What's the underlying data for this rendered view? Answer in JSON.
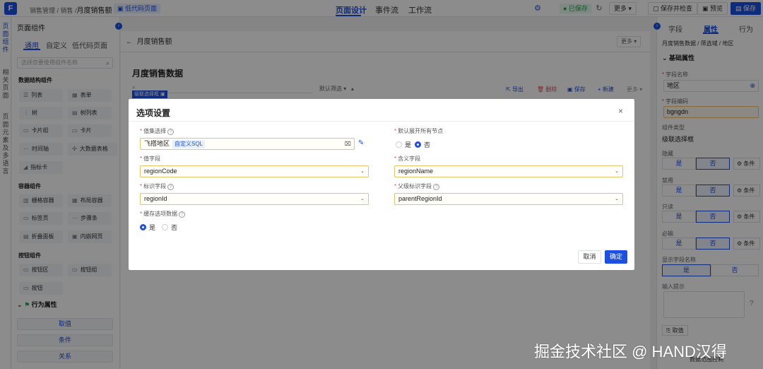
{
  "topbar": {
    "breadcrumb_prefix": "销售管理 / 销售 /",
    "page_name": "月度销售额",
    "low_code_tag": "低代码页面",
    "tabs": [
      "页面设计",
      "事件流",
      "工作流"
    ],
    "saved": "已保存",
    "more": "更多",
    "save_check": "保存并检查",
    "preview": "预览",
    "save": "保存"
  },
  "left_strip": {
    "items": [
      "页面组件",
      "相关页面",
      "页面元素及多语言"
    ]
  },
  "left_panel": {
    "title": "页面组件",
    "tabs": [
      "通用",
      "自定义",
      "低代码页面"
    ],
    "search_placeholder": "选择您要使用组件名称",
    "sections": {
      "data": "数据结构组件",
      "container": "容器组件",
      "button": "按钮组件"
    },
    "data_items": [
      "列表",
      "表单",
      "树",
      "树列表",
      "卡片组",
      "卡片",
      "时间轴",
      "大数据表格",
      "指标卡"
    ],
    "container_items": [
      "栅格容器",
      "布局容器",
      "标签页",
      "步骤条",
      "折叠面板",
      "内嵌网页"
    ],
    "button_items": [
      "按钮区",
      "按钮组",
      "按钮"
    ],
    "behavior_title": "行为属性",
    "behavior_buttons": [
      "取值",
      "条件",
      "关系"
    ]
  },
  "canvas": {
    "back_title": "月度销售额",
    "more": "更多",
    "page_title": "月度销售数据",
    "quick_query": "默认筛选",
    "tools": [
      "导出",
      "删除",
      "保存",
      "新建",
      "更多"
    ],
    "selected_chip": "级联选择框"
  },
  "right_panel": {
    "tabs": [
      "字段",
      "属性",
      "行为"
    ],
    "breadcrumb": "月度销售数据 / 筛选域 / 地区",
    "section": "基础属性",
    "field_name_label": "字段名称",
    "field_name_value": "地区",
    "field_code_label": "字段编码",
    "field_code_value": "bgngdn",
    "comp_type_label": "组件类型",
    "comp_type_value": "级联选择框",
    "hidden_label": "隐藏",
    "disabled_label": "禁用",
    "readonly_label": "只读",
    "required_label": "必输",
    "show_name_label": "显示字段名称",
    "yes": "是",
    "no": "否",
    "condition": "条件",
    "hint_label": "输入提示",
    "take_value": "取值",
    "data_scope": "数据范围控制"
  },
  "modal": {
    "title": "选项设置",
    "value_set_label": "值集选择",
    "value_set_value": "飞搭地区",
    "value_set_tag": "自定义SQL",
    "expand_all_label": "默认展开所有节点",
    "value_field_label": "值字段",
    "value_field_value": "regionCode",
    "meaning_field_label": "含义字段",
    "meaning_field_value": "regionName",
    "id_field_label": "标识字段",
    "id_field_value": "regionId",
    "parent_id_label": "父级标识字段",
    "parent_id_value": "parentRegionId",
    "cache_label": "缓存选项数据",
    "yes": "是",
    "no": "否",
    "cancel": "取消",
    "confirm": "确定"
  },
  "watermark": "掘金技术社区 @ HAND汉得",
  "colors": {
    "primary": "#1d4fe0",
    "danger": "#e34d59",
    "success": "#17a34a"
  }
}
